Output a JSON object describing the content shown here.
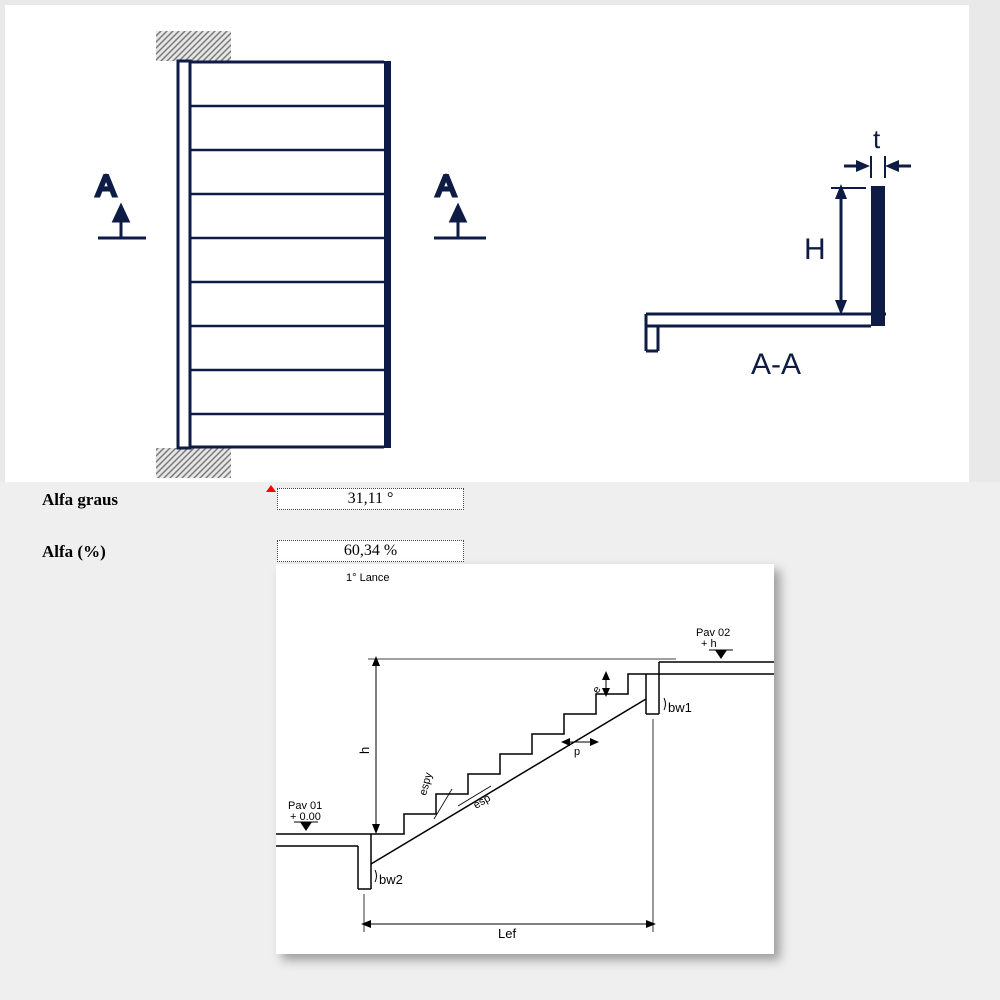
{
  "top_diagram": {
    "section_label_left": "A",
    "section_label_right": "A",
    "section_name": "A-A",
    "dim_height": "H",
    "dim_thickness": "t"
  },
  "form": {
    "alfa_graus_label": "Alfa graus",
    "alfa_graus_value": "31,11 °",
    "alfa_pct_label": "Alfa (%)",
    "alfa_pct_value": "60,34 %"
  },
  "stair_diagram": {
    "title": "1° Lance",
    "pav01_name": "Pav 01",
    "pav01_level": "+ 0.00",
    "pav02_name": "Pav 02",
    "pav02_level": "+ h",
    "lef": "Lef",
    "bw1": "bw1",
    "bw2": "bw2",
    "h": "h",
    "e": "e",
    "p": "p",
    "esp": "esp",
    "espy": "espy"
  }
}
